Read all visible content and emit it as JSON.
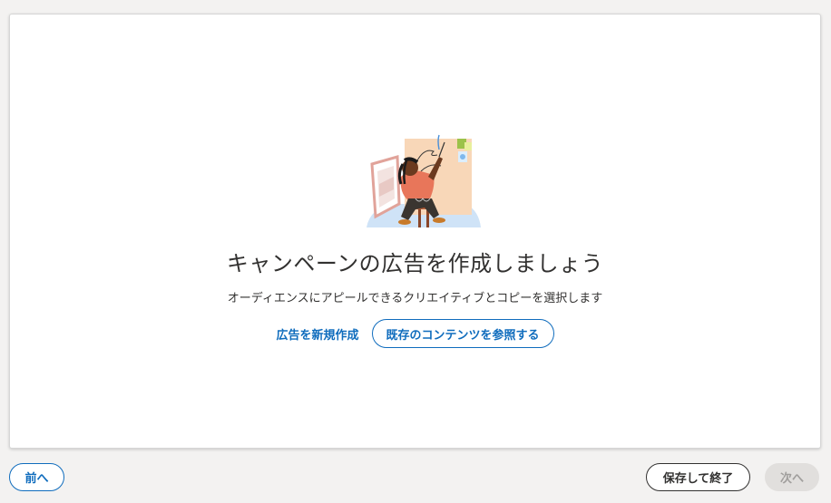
{
  "main": {
    "title": "キャンペーンの広告を作成しましょう",
    "subtitle": "オーディエンスにアピールできるクリエイティブとコピーを選択します",
    "create_new_label": "広告を新規作成",
    "browse_existing_label": "既存のコンテンツを参照する"
  },
  "footer": {
    "back_label": "前へ",
    "save_exit_label": "保存して終了",
    "next_label": "次へ"
  },
  "colors": {
    "accent": "#0f6cbd",
    "text": "#323130",
    "disabled_bg": "#e1dfdd",
    "disabled_text": "#a19f9d"
  },
  "icons": {
    "illustration": "artist-painting-illustration"
  }
}
